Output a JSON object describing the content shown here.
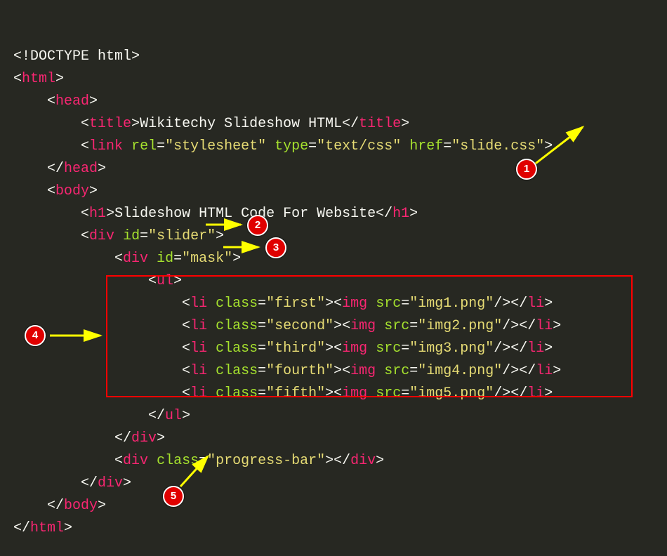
{
  "code": {
    "doctype": "<!DOCTYPE html>",
    "html_open_b": "<",
    "html_open_n": "html",
    "html_open_e": ">",
    "head_open_b": "<",
    "head_open_n": "head",
    "head_open_e": ">",
    "title_ob": "<",
    "title_on": "title",
    "title_oe": ">",
    "title_text": "Wikitechy Slideshow HTML",
    "title_cb": "</",
    "title_cn": "title",
    "title_ce": ">",
    "link_ob": "<",
    "link_on": "link",
    "link_rel_k": "rel",
    "link_rel_eq": "=",
    "link_rel_v": "\"stylesheet\"",
    "link_type_k": "type",
    "link_type_eq": "=",
    "link_type_v": "\"text/css\"",
    "link_href_k": "href",
    "link_href_eq": "=",
    "link_href_v": "\"slide.css\"",
    "link_oe": ">",
    "head_cb": "</",
    "head_cn": "head",
    "head_ce": ">",
    "body_ob": "<",
    "body_on": "body",
    "body_oe": ">",
    "h1_ob": "<",
    "h1_on": "h1",
    "h1_oe": ">",
    "h1_text": "Slideshow HTML Code For Website",
    "h1_cb": "</",
    "h1_cn": "h1",
    "h1_ce": ">",
    "div1_ob": "<",
    "div1_on": "div",
    "div1_id_k": "id",
    "div1_eq": "=",
    "div1_id_v": "\"slider\"",
    "div1_oe": ">",
    "div2_ob": "<",
    "div2_on": "div",
    "div2_id_k": "id",
    "div2_eq": "=",
    "div2_id_v": "\"mask\"",
    "div2_oe": ">",
    "ul_ob": "<",
    "ul_on": "ul",
    "ul_oe": ">",
    "li1_ob": "<",
    "li1_on": "li",
    "li1_ck": "class",
    "li1_eq": "=",
    "li1_cv": "\"first\"",
    "li1_oe": "><",
    "li1_imgn": "img",
    "li1_sk": "src",
    "li1_seq": "=",
    "li1_sv": "\"img1.png\"",
    "li1_ic": "/></",
    "li1_lin": "li",
    "li1_ce": ">",
    "li2_ob": "<",
    "li2_on": "li",
    "li2_ck": "class",
    "li2_eq": "=",
    "li2_cv": "\"second\"",
    "li2_oe": "><",
    "li2_imgn": "img",
    "li2_sk": "src",
    "li2_seq": "=",
    "li2_sv": "\"img2.png\"",
    "li2_ic": "/></",
    "li2_lin": "li",
    "li2_ce": ">",
    "li3_ob": "<",
    "li3_on": "li",
    "li3_ck": "class",
    "li3_eq": "=",
    "li3_cv": "\"third\"",
    "li3_oe": "><",
    "li3_imgn": "img",
    "li3_sk": "src",
    "li3_seq": "=",
    "li3_sv": "\"img3.png\"",
    "li3_ic": "/></",
    "li3_lin": "li",
    "li3_ce": ">",
    "li4_ob": "<",
    "li4_on": "li",
    "li4_ck": "class",
    "li4_eq": "=",
    "li4_cv": "\"fourth\"",
    "li4_oe": "><",
    "li4_imgn": "img",
    "li4_sk": "src",
    "li4_seq": "=",
    "li4_sv": "\"img4.png\"",
    "li4_ic": "/></",
    "li4_lin": "li",
    "li4_ce": ">",
    "li5_ob": "<",
    "li5_on": "li",
    "li5_ck": "class",
    "li5_eq": "=",
    "li5_cv": "\"fifth\"",
    "li5_oe": "><",
    "li5_imgn": "img",
    "li5_sk": "src",
    "li5_seq": "=",
    "li5_sv": "\"img5.png\"",
    "li5_ic": "/></",
    "li5_lin": "li",
    "li5_ce": ">",
    "ul_cb": "</",
    "ul_cn": "ul",
    "ul_ce": ">",
    "div2_cb": "</",
    "div2_cn": "div",
    "div2_ce": ">",
    "div3_ob": "<",
    "div3_on": "div",
    "div3_ck": "class",
    "div3_eq": "=",
    "div3_cv": "\"progress-bar\"",
    "div3_oe": "></",
    "div3_cn": "div",
    "div3_ce": ">",
    "div1_cb": "</",
    "div1_cn": "div",
    "div1_ce": ">",
    "body_cb": "</",
    "body_cn": "body",
    "body_ce": ">",
    "html_cb": "</",
    "html_cn": "html",
    "html_ce": ">"
  },
  "badges": {
    "b1": "1",
    "b2": "2",
    "b3": "3",
    "b4": "4",
    "b5": "5"
  }
}
